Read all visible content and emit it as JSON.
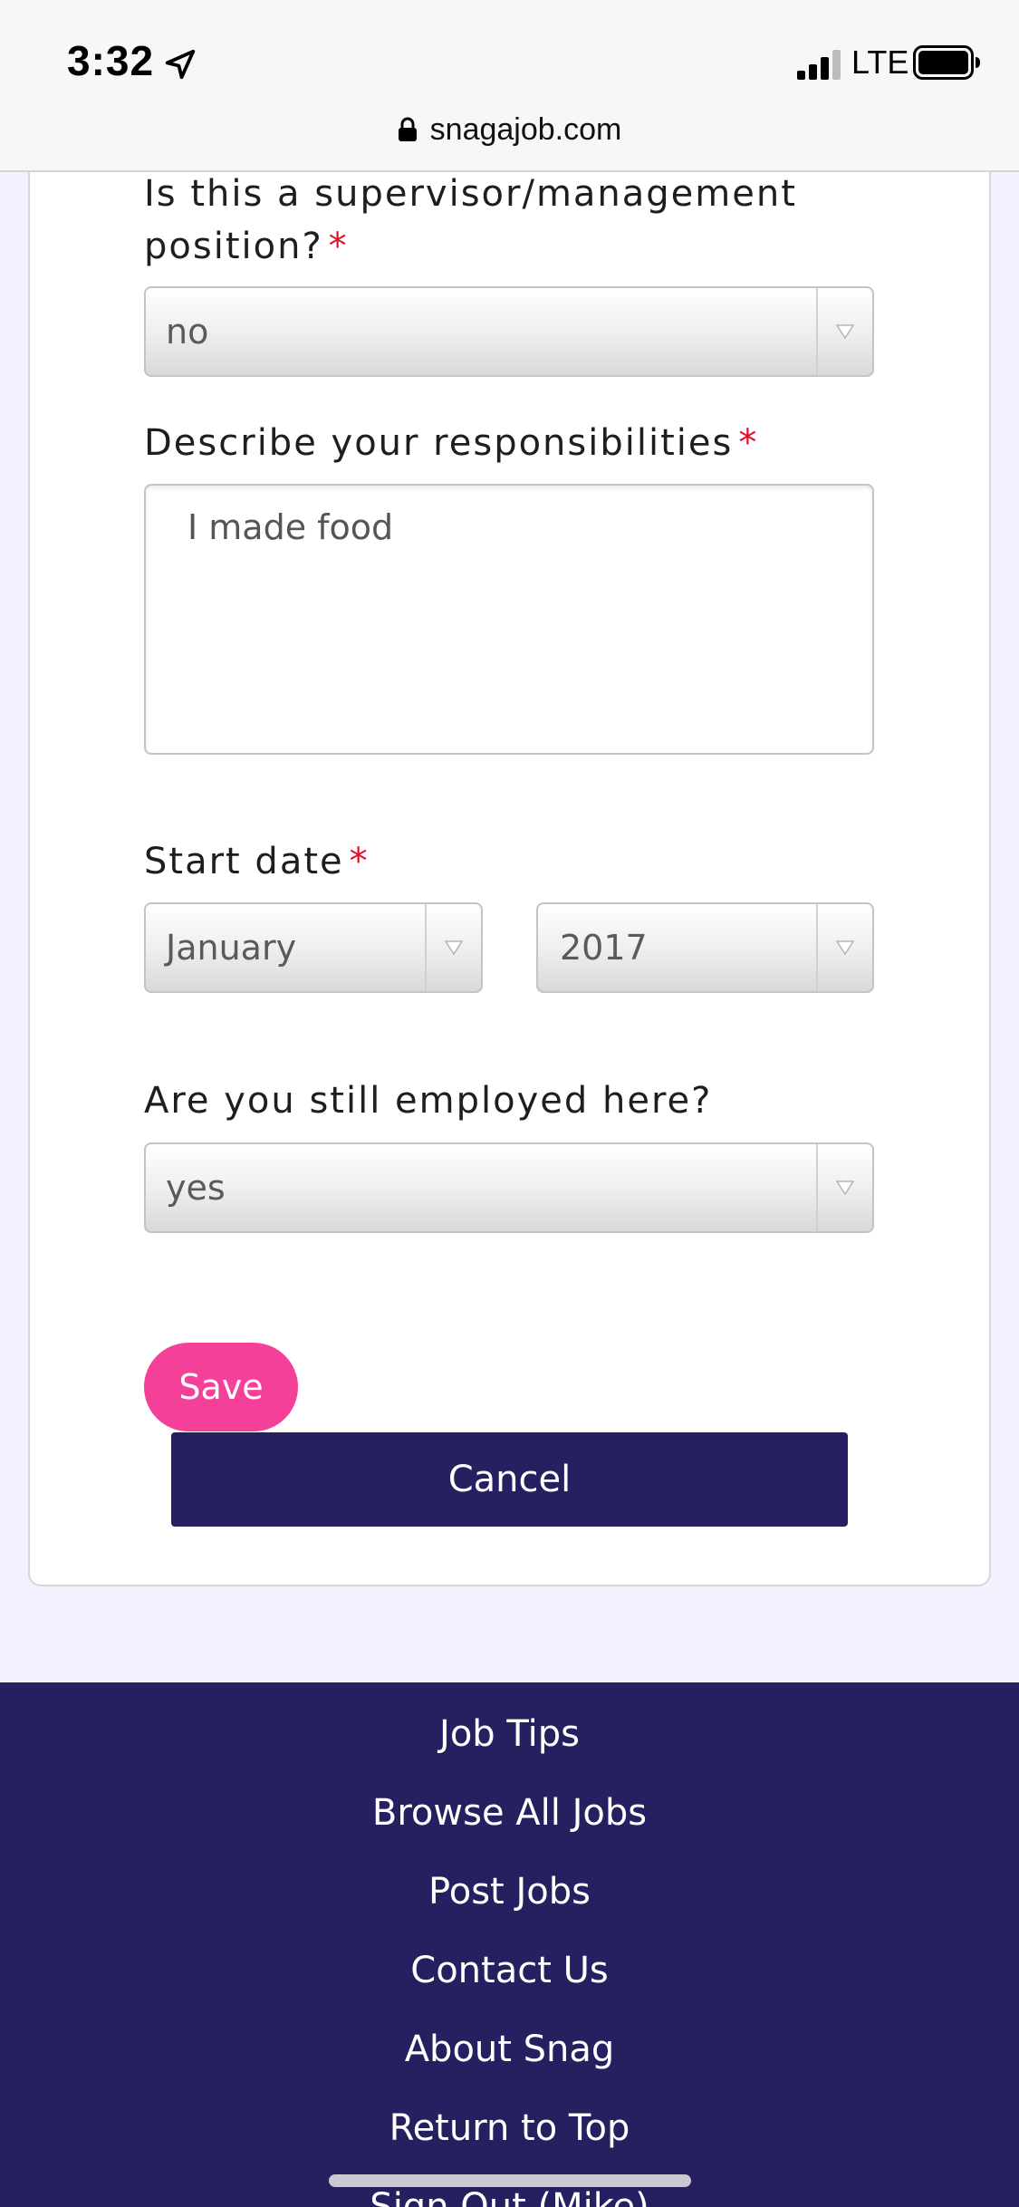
{
  "status_bar": {
    "time": "3:32",
    "network": "LTE"
  },
  "browser": {
    "url": "snagajob.com"
  },
  "form": {
    "supervisor": {
      "label_line1": "Is this a supervisor/management",
      "label_line2": "position?",
      "required_mark": "*",
      "value": "no"
    },
    "responsibilities": {
      "label": "Describe your responsibilities",
      "required_mark": "*",
      "value": "I made food"
    },
    "start_date": {
      "label": "Start date",
      "required_mark": "*",
      "month": "January",
      "year": "2017"
    },
    "still_employed": {
      "label": "Are you still employed here?",
      "value": "yes"
    },
    "save_label": "Save",
    "cancel_label": "Cancel"
  },
  "footer": {
    "links": [
      "Job Tips",
      "Browse All Jobs",
      "Post Jobs",
      "Contact Us",
      "About Snag",
      "Return to Top",
      "Sign Out (Mike)"
    ]
  },
  "colors": {
    "brand_navy": "#262060",
    "save_pink": "#f5409a",
    "required_red": "#e0102a",
    "page_background": "#f1f2fd"
  }
}
